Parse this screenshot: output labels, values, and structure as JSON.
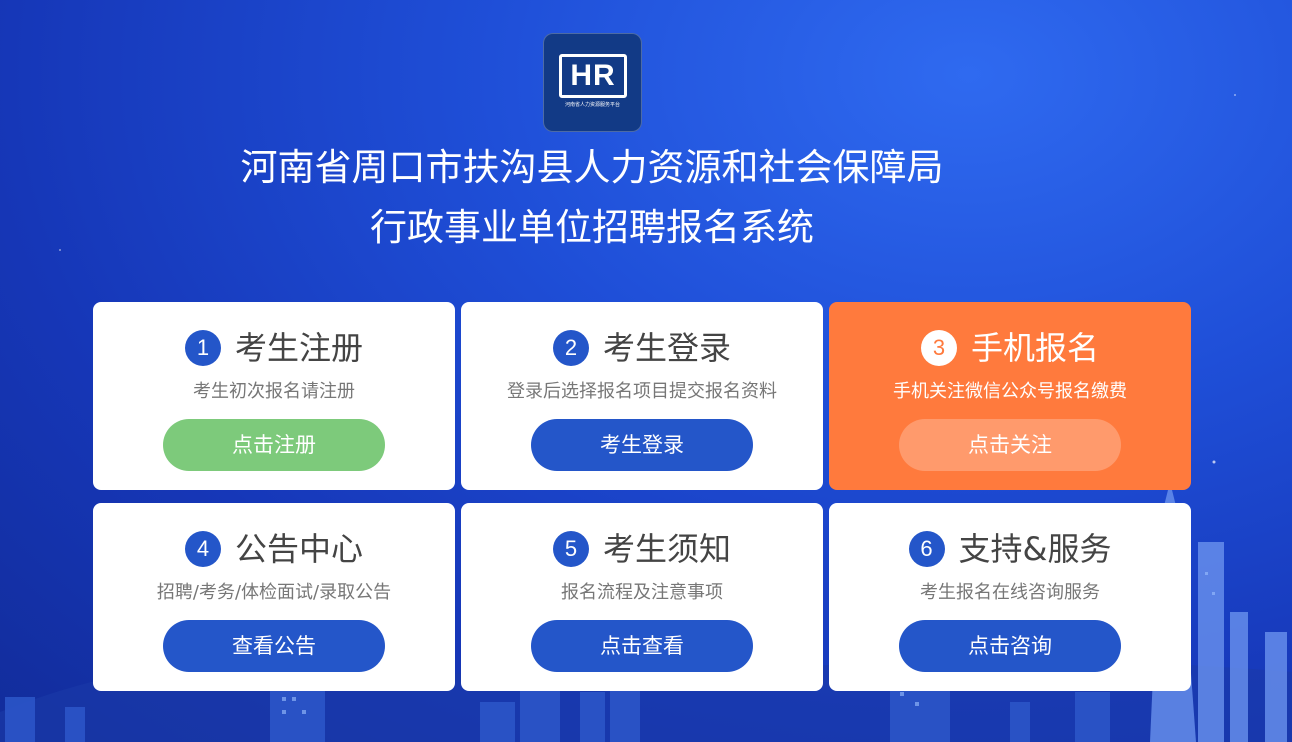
{
  "logo": {
    "mark": "HR",
    "subtitle": "河南省人力资源服务平台"
  },
  "header": {
    "title_line1": "河南省周口市扶沟县人力资源和社会保障局",
    "title_line2": "行政事业单位招聘报名系统"
  },
  "cards": [
    {
      "number": "1",
      "title": "考生注册",
      "desc": "考生初次报名请注册",
      "button": "点击注册"
    },
    {
      "number": "2",
      "title": "考生登录",
      "desc": "登录后选择报名项目提交报名资料",
      "button": "考生登录"
    },
    {
      "number": "3",
      "title": "手机报名",
      "desc": "手机关注微信公众号报名缴费",
      "button": "点击关注"
    },
    {
      "number": "4",
      "title": "公告中心",
      "desc": "招聘/考务/体检面试/录取公告",
      "button": "查看公告"
    },
    {
      "number": "5",
      "title": "考生须知",
      "desc": "报名流程及注意事项",
      "button": "点击查看"
    },
    {
      "number": "6",
      "title": "支持&服务",
      "desc": "考生报名在线咨询服务",
      "button": "点击咨询"
    }
  ],
  "colors": {
    "primary_blue": "#2456c9",
    "register_green": "#7dca7b",
    "highlight_orange": "#ff7a3d",
    "orange_button": "#ff9a6c"
  }
}
